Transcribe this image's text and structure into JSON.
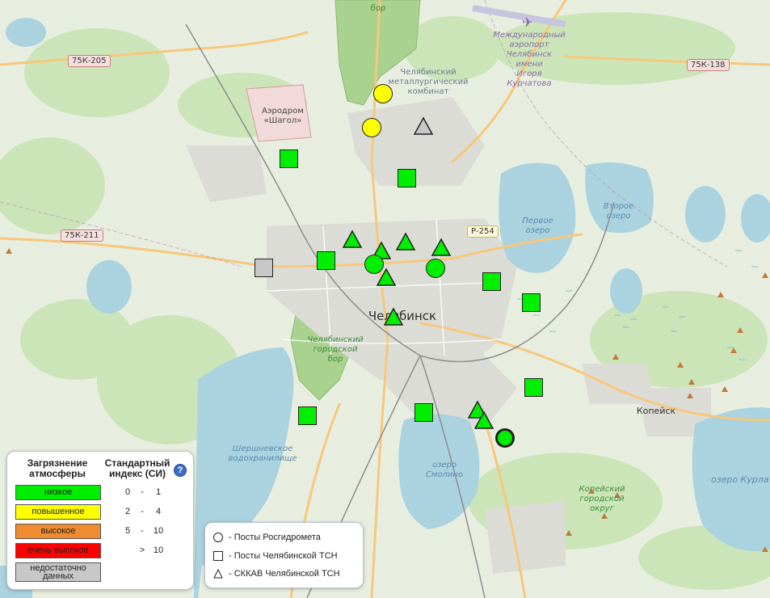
{
  "map": {
    "city_label": "Челябинск",
    "labels": [
      {
        "text": "бор",
        "kind": "green"
      },
      {
        "text": "Челябинский\nметаллургический\nкомбинат",
        "kind": "plain"
      },
      {
        "text": "Международный\nаэропорт\nЧелябинск\nимени\nИгоря\nКурчатова",
        "kind": "airport"
      },
      {
        "text": "Аэродром\n«Шагол»",
        "kind": "plain"
      },
      {
        "text": "Первое\nозеро",
        "kind": "water"
      },
      {
        "text": "Второе\nозеро",
        "kind": "water"
      },
      {
        "text": "Челябинский\nгородской\nбор",
        "kind": "green"
      },
      {
        "text": "Шершневское\nводохранилище",
        "kind": "water"
      },
      {
        "text": "озеро\nСмолино",
        "kind": "water"
      },
      {
        "text": "Копейск",
        "kind": "town"
      },
      {
        "text": "Копейский\nгородской\nокруг",
        "kind": "green"
      },
      {
        "text": "озеро Курла",
        "kind": "water"
      }
    ],
    "road_shields": [
      "75К-205",
      "75К-138",
      "75К-211",
      "Р-254"
    ]
  },
  "colors": {
    "low": "#00ee00",
    "elevated": "#ffff00",
    "high": "#f08c30",
    "very_high": "#ff0000",
    "no_data": "#c8c8c8"
  },
  "stations": [
    {
      "type": "circle",
      "status": "elevated"
    },
    {
      "type": "circle",
      "status": "elevated"
    },
    {
      "type": "triangle",
      "status": "no_data"
    },
    {
      "type": "square",
      "status": "low"
    },
    {
      "type": "square",
      "status": "low"
    },
    {
      "type": "triangle",
      "status": "low"
    },
    {
      "type": "triangle",
      "status": "low"
    },
    {
      "type": "triangle",
      "status": "low"
    },
    {
      "type": "triangle",
      "status": "low"
    },
    {
      "type": "square",
      "status": "no_data"
    },
    {
      "type": "square",
      "status": "low"
    },
    {
      "type": "circle",
      "status": "low"
    },
    {
      "type": "circle",
      "status": "low"
    },
    {
      "type": "triangle",
      "status": "low"
    },
    {
      "type": "square",
      "status": "low"
    },
    {
      "type": "square",
      "status": "low"
    },
    {
      "type": "triangle",
      "status": "low"
    },
    {
      "type": "square",
      "status": "low"
    },
    {
      "type": "square",
      "status": "low"
    },
    {
      "type": "square",
      "status": "low"
    },
    {
      "type": "triangle",
      "status": "low"
    },
    {
      "type": "triangle",
      "status": "low"
    },
    {
      "type": "circle",
      "status": "low",
      "highlighted": true
    }
  ],
  "legend": {
    "pollution_header": "Загрязнение атмосферы",
    "index_header": "Стандартный индекс (СИ)",
    "help_symbol": "?",
    "levels": [
      {
        "label": "низкое",
        "from": "0",
        "dash": "-",
        "to": "1",
        "color_key": "low"
      },
      {
        "label": "повышенное",
        "from": "2",
        "dash": "-",
        "to": "4",
        "color_key": "elevated"
      },
      {
        "label": "высокое",
        "from": "5",
        "dash": "-",
        "to": "10",
        "color_key": "high"
      },
      {
        "label": "очень высокое",
        "from": "",
        "dash": ">",
        "to": "10",
        "color_key": "very_high"
      },
      {
        "label": "недостаточно данных",
        "from": "",
        "dash": "",
        "to": "",
        "color_key": "no_data"
      }
    ]
  },
  "station_types": [
    {
      "shape": "circle",
      "label": "- Посты Росгидромета"
    },
    {
      "shape": "square",
      "label": "- Посты Челябинской ТСН"
    },
    {
      "shape": "triangle",
      "label": "- СККАВ Челябинской ТСН"
    }
  ]
}
